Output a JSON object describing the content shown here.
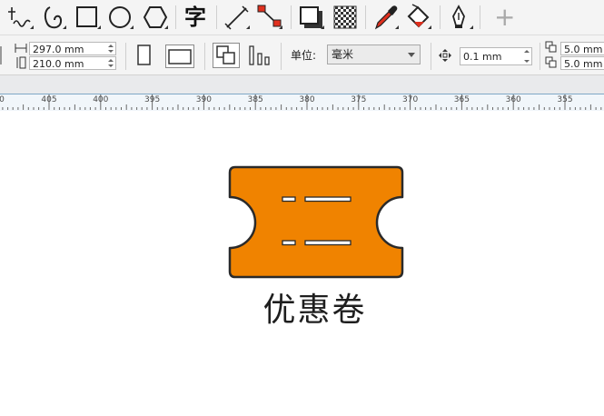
{
  "toolbox": {
    "tools": [
      {
        "name": "freehand-tool",
        "icon": "freehand-icon"
      },
      {
        "name": "artistic-media-tool",
        "icon": "spiral-icon"
      },
      {
        "name": "rectangle-tool",
        "icon": "rectangle-icon"
      },
      {
        "name": "ellipse-tool",
        "icon": "ellipse-icon"
      },
      {
        "name": "polygon-tool",
        "icon": "hexagon-icon"
      },
      {
        "name": "text-tool",
        "icon": "text-icon",
        "glyph": "字"
      },
      {
        "name": "dimension-tool",
        "icon": "dimension-line-icon"
      },
      {
        "name": "connector-tool",
        "icon": "connector-icon"
      },
      {
        "name": "drop-shadow-tool",
        "icon": "drop-shadow-icon"
      },
      {
        "name": "transparency-tool",
        "icon": "checkerboard-icon"
      },
      {
        "name": "eyedropper-tool",
        "icon": "eyedropper-icon"
      },
      {
        "name": "interactive-fill-tool",
        "icon": "paint-bucket-icon"
      },
      {
        "name": "pen-tool",
        "icon": "pen-nib-icon"
      },
      {
        "name": "add-tool",
        "icon": "plus-icon",
        "glyph": "+"
      }
    ]
  },
  "property_bar": {
    "page_width": "297.0 mm",
    "page_height": "210.0 mm",
    "units_label": "单位:",
    "units_value": "毫米",
    "nudge_value": "0.1 mm",
    "duplicate_x": "5.0 mm",
    "duplicate_y": "5.0 mm"
  },
  "ruler": {
    "labels": [
      "405",
      "400",
      "395",
      "390",
      "385",
      "380",
      "375",
      "370",
      "365",
      "360",
      "355"
    ]
  },
  "canvas": {
    "ticket_title": "优惠卷",
    "ticket_fill": "#f08300",
    "ticket_stroke": "#2a2a2a"
  }
}
